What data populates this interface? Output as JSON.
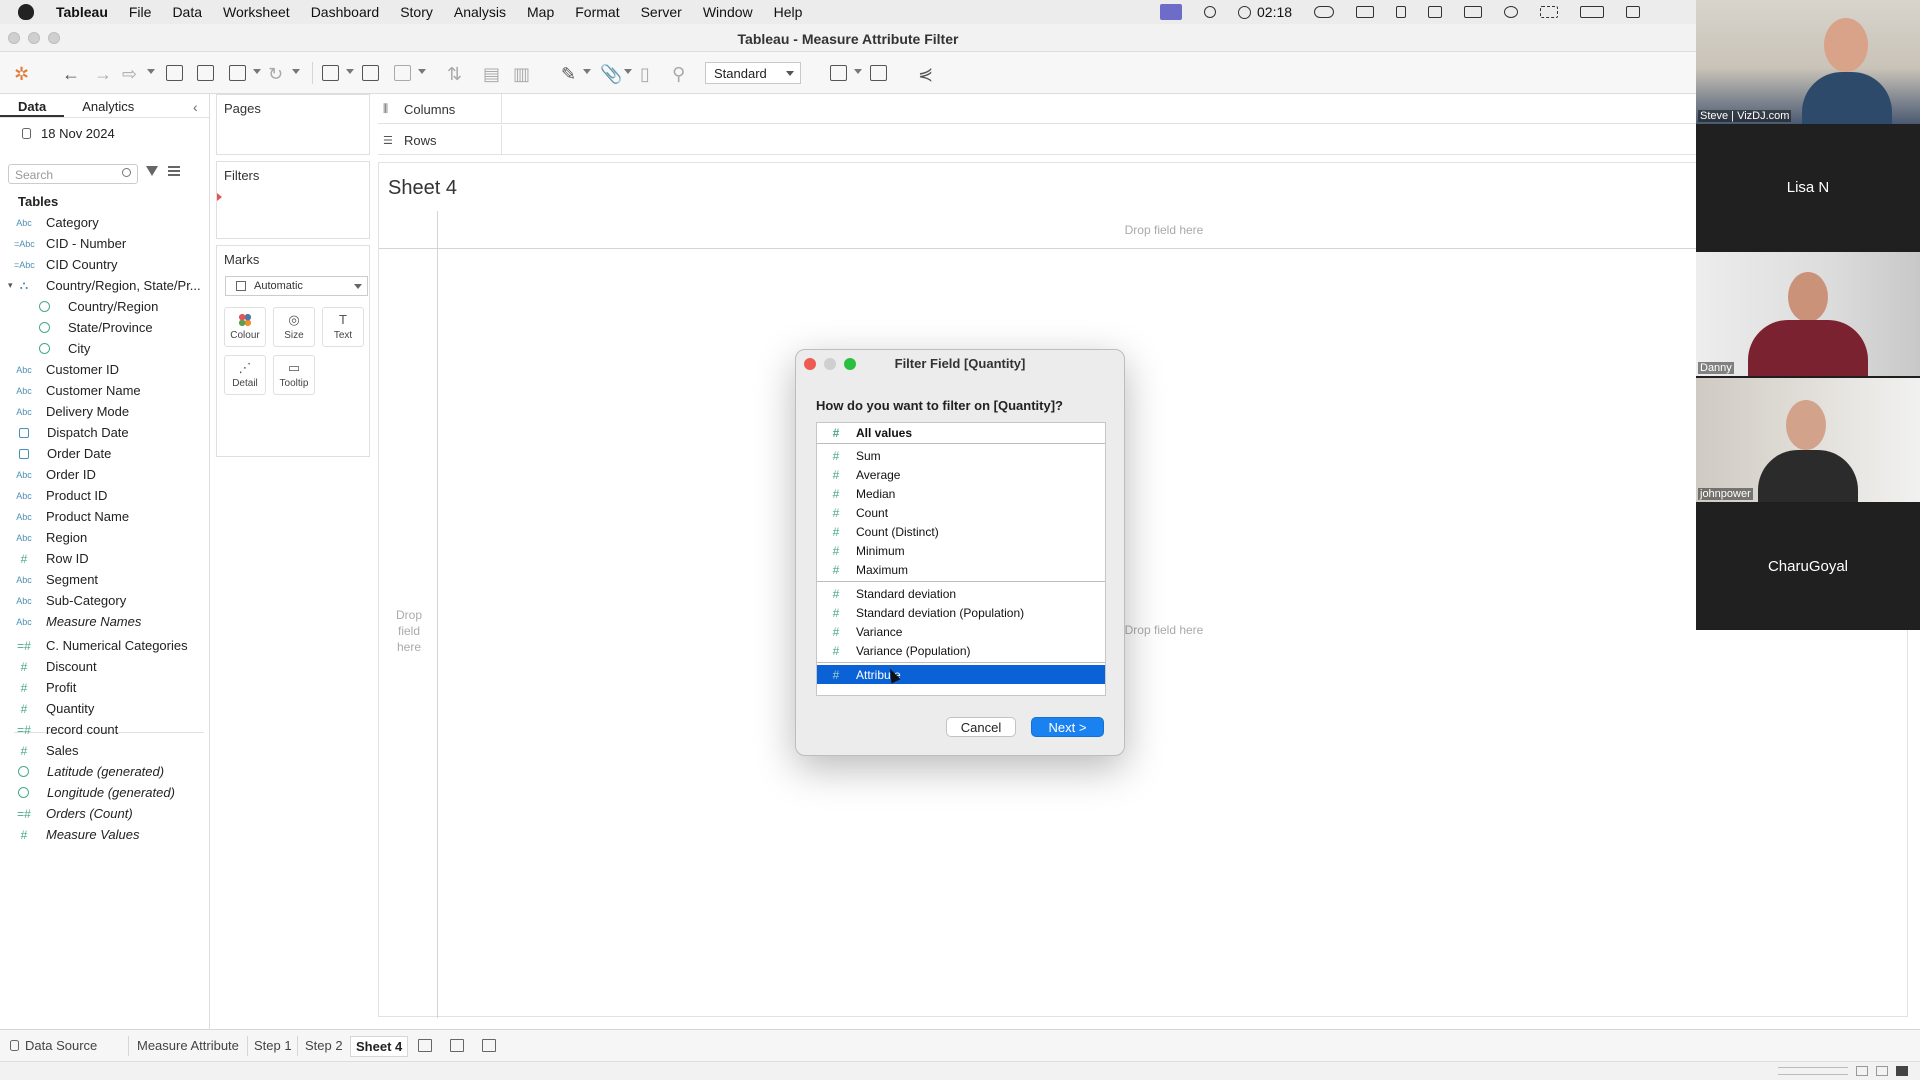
{
  "menubar": {
    "app": "Tableau",
    "items": [
      "File",
      "Data",
      "Worksheet",
      "Dashboard",
      "Story",
      "Analysis",
      "Map",
      "Format",
      "Server",
      "Window",
      "Help"
    ],
    "clock": "02:18"
  },
  "window": {
    "title": "Tableau - Measure Attribute Filter"
  },
  "toolbar": {
    "fit_value": "Standard"
  },
  "data_pane": {
    "tabs": [
      "Data",
      "Analytics"
    ],
    "datasource": "18 Nov 2024",
    "search_placeholder": "Search",
    "tables_heading": "Tables",
    "fields": [
      {
        "label": "Category",
        "type": "Abc"
      },
      {
        "label": "CID - Number",
        "type": "=Abc"
      },
      {
        "label": "CID Country",
        "type": "=Abc"
      },
      {
        "label": "Country/Region, State/Pr...",
        "type": "hier"
      },
      {
        "label": "Country/Region",
        "type": "geo"
      },
      {
        "label": "State/Province",
        "type": "geo"
      },
      {
        "label": "City",
        "type": "geo"
      },
      {
        "label": "Customer ID",
        "type": "Abc"
      },
      {
        "label": "Customer Name",
        "type": "Abc"
      },
      {
        "label": "Delivery Mode",
        "type": "Abc"
      },
      {
        "label": "Dispatch Date",
        "type": "date"
      },
      {
        "label": "Order Date",
        "type": "date"
      },
      {
        "label": "Order ID",
        "type": "Abc"
      },
      {
        "label": "Product ID",
        "type": "Abc"
      },
      {
        "label": "Product Name",
        "type": "Abc"
      },
      {
        "label": "Region",
        "type": "Abc"
      },
      {
        "label": "Row ID",
        "type": "#"
      },
      {
        "label": "Segment",
        "type": "Abc"
      },
      {
        "label": "Sub-Category",
        "type": "Abc"
      },
      {
        "label": "Measure Names",
        "type": "Abc"
      },
      {
        "label": "C. Numerical Categories",
        "type": "=#"
      },
      {
        "label": "Discount",
        "type": "#"
      },
      {
        "label": "Profit",
        "type": "#"
      },
      {
        "label": "Quantity",
        "type": "#"
      },
      {
        "label": "record count",
        "type": "=#"
      },
      {
        "label": "Sales",
        "type": "#"
      },
      {
        "label": "Latitude (generated)",
        "type": "geo"
      },
      {
        "label": "Longitude (generated)",
        "type": "geo"
      },
      {
        "label": "Orders (Count)",
        "type": "=#"
      },
      {
        "label": "Measure Values",
        "type": "#"
      }
    ]
  },
  "cards": {
    "pages": "Pages",
    "filters": "Filters",
    "marks": "Marks",
    "mark_type": "Automatic",
    "mark_buttons": [
      "Colour",
      "Size",
      "Text",
      "Detail",
      "Tooltip"
    ]
  },
  "shelves": {
    "columns": "Columns",
    "rows": "Rows"
  },
  "view": {
    "sheet_title": "Sheet 4",
    "drop_top": "Drop field here",
    "drop_left": "Drop\nfield\nhere",
    "drop_right": "Drop field here"
  },
  "dialog": {
    "title": "Filter Field [Quantity]",
    "question": "How do you want to filter on [Quantity]?",
    "options_group1": [
      "All values"
    ],
    "options_group2": [
      "Sum",
      "Average",
      "Median",
      "Count",
      "Count (Distinct)",
      "Minimum",
      "Maximum"
    ],
    "options_group3": [
      "Standard deviation",
      "Standard deviation (Population)",
      "Variance",
      "Variance (Population)"
    ],
    "options_group4": [
      "Attribute"
    ],
    "selected": "Attribute",
    "cancel": "Cancel",
    "next": "Next >"
  },
  "sheet_tabs": {
    "data_source": "Data Source",
    "tabs": [
      "Measure Attribute",
      "Step 1",
      "Step 2",
      "Sheet 4"
    ],
    "active": "Sheet 4"
  },
  "participants": [
    "Steve | VizDJ.com",
    "Lisa N",
    "Danny",
    "johnpower",
    "CharuGoyal"
  ],
  "colors": {
    "selection": "#0a62d6",
    "primary_button": "#1a82f0",
    "measure_icon": "#4aa88a",
    "dimension_icon": "#4c8fb4"
  }
}
